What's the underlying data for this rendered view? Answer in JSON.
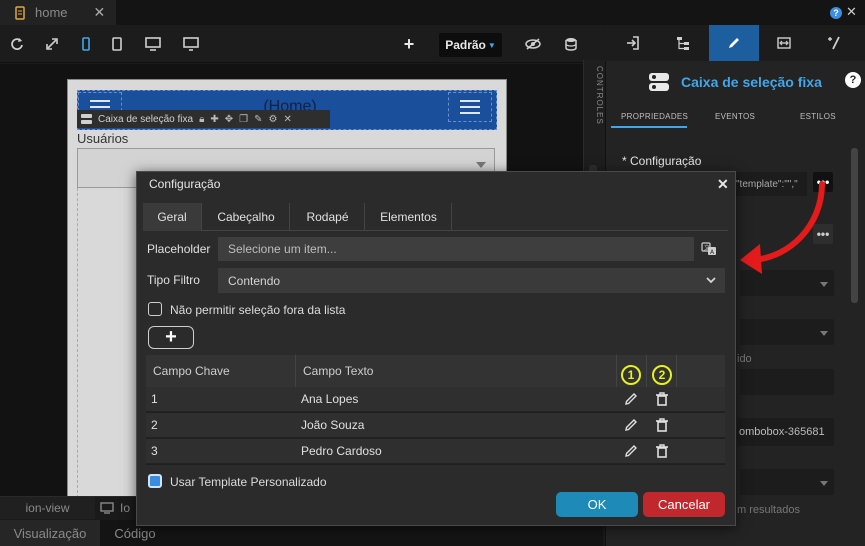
{
  "window": {
    "tab_label": "home"
  },
  "toolbar": {
    "mode_label": "Padrão",
    "icons": [
      "refresh-icon",
      "expand-icon",
      "phone-icon",
      "tablet-icon",
      "desktop-icon",
      "monitor-icon",
      "add-icon",
      "eye-slash-icon",
      "database-icon"
    ]
  },
  "canvas": {
    "phone_title": "(Home)",
    "selection_bar_label": "Caixa de seleção fixa",
    "component_label": "Usuários",
    "controles_label": "CONTROLES"
  },
  "bottom": {
    "tab_ionview": "ion-view",
    "tab_io": "Io",
    "nav_visual": "Visualização",
    "nav_codigo": "Código"
  },
  "right_panel": {
    "title": "Caixa de seleção fixa",
    "subtabs": [
      "PROPRIEDADES",
      "EVENTOS",
      "ESTILOS"
    ],
    "config_label": "* Configuração",
    "config_value": "\"template\":\"\",\"",
    "faint_texts": [
      "ido",
      "ombobox-365681",
      "m resultados"
    ],
    "accent_color": "#3ea8ea"
  },
  "dialog": {
    "title": "Configuração",
    "tabs": [
      "Geral",
      "Cabeçalho",
      "Rodapé",
      "Elementos"
    ],
    "placeholder_label": "Placeholder",
    "placeholder_value": "Selecione um item...",
    "tipo_filtro_label": "Tipo Filtro",
    "tipo_filtro_value": "Contendo",
    "checkbox_nao_label": "Não permitir seleção fora da lista",
    "checkbox_nao_checked": false,
    "add_button": "+",
    "grid": {
      "columns": [
        "Campo Chave",
        "Campo Texto"
      ],
      "markers": [
        "1",
        "2"
      ],
      "rows": [
        {
          "key": "1",
          "text": "Ana Lopes"
        },
        {
          "key": "2",
          "text": "João Souza"
        },
        {
          "key": "3",
          "text": "Pedro Cardoso"
        }
      ]
    },
    "checkbox_usar_label": "Usar Template Personalizado",
    "checkbox_usar_checked": true,
    "ok_label": "OK",
    "cancel_label": "Cancelar",
    "ok_color": "#1e8ab8",
    "cancel_color": "#c0282d"
  }
}
